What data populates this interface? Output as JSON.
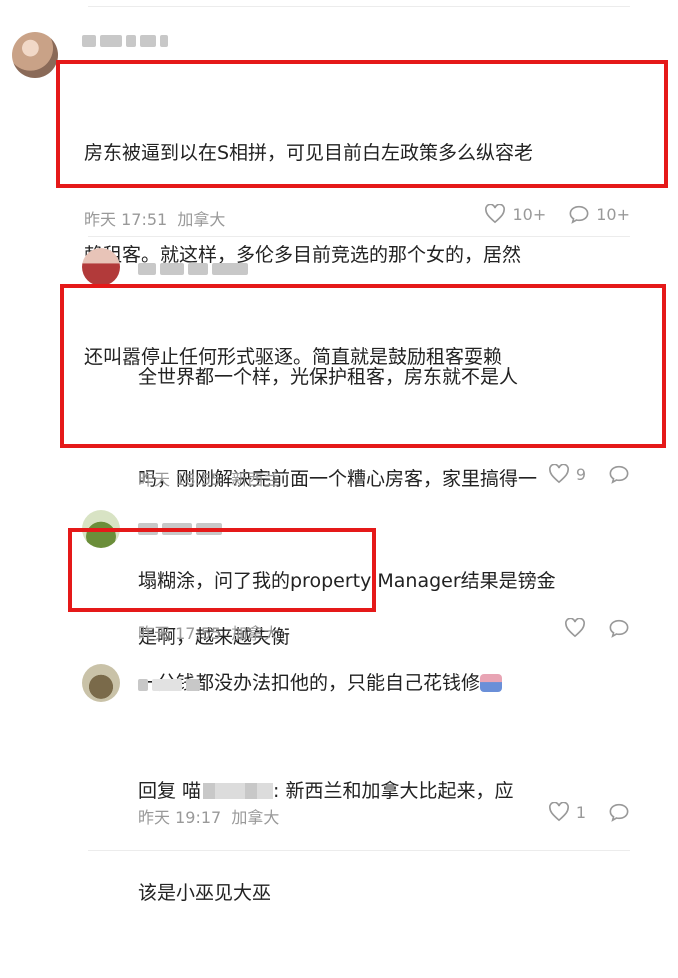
{
  "comments": [
    {
      "text": "房东被逼到以在S相拼，可见目前白左政策多么纵容老赖租客。就这样，多伦多目前竞选的那个女的，居然还叫嚣停止任何形式驱逐。简直就是鼓励租客耍赖",
      "lines": [
        "房东被逼到以在S相拼，可见目前白左政策多么纵容老",
        "赖租客。就这样，多伦多目前竞选的那个女的，居然",
        "还叫嚣停止任何形式驱逐。简直就是鼓励租客耍赖"
      ],
      "time": "昨天 17:51",
      "location": "加拿大",
      "likes": "10+",
      "replies": "10+"
    },
    {
      "lines": [
        "全世界都一个样，光保护租客，房东就不是人",
        "吗，刚刚解决完前面一个糟心房客，家里搞得一",
        "塌糊涂，问了我的property Manager结果是镑金",
        "一分钱都没办法扣他的，只能自己花钱修"
      ],
      "time": "昨天 18:55",
      "location": "新西兰",
      "likes": "9",
      "replies": ""
    },
    {
      "lines": [
        "是啊，越来越失衡"
      ],
      "time": "昨天 17:55",
      "location": "加拿大",
      "likes": "",
      "replies": ""
    },
    {
      "reply_prefix": "回复 喵",
      "reply_suffix": ": 新西兰和加拿大比起来，应",
      "lines2": "该是小巫见大巫",
      "time": "昨天 19:17",
      "location": "加拿大",
      "likes": "1",
      "replies": ""
    }
  ],
  "icons": {
    "like": "heart-outline-icon",
    "reply": "speech-bubble-icon"
  },
  "colors": {
    "highlight_box": "#e51919",
    "meta_text": "#999999"
  }
}
